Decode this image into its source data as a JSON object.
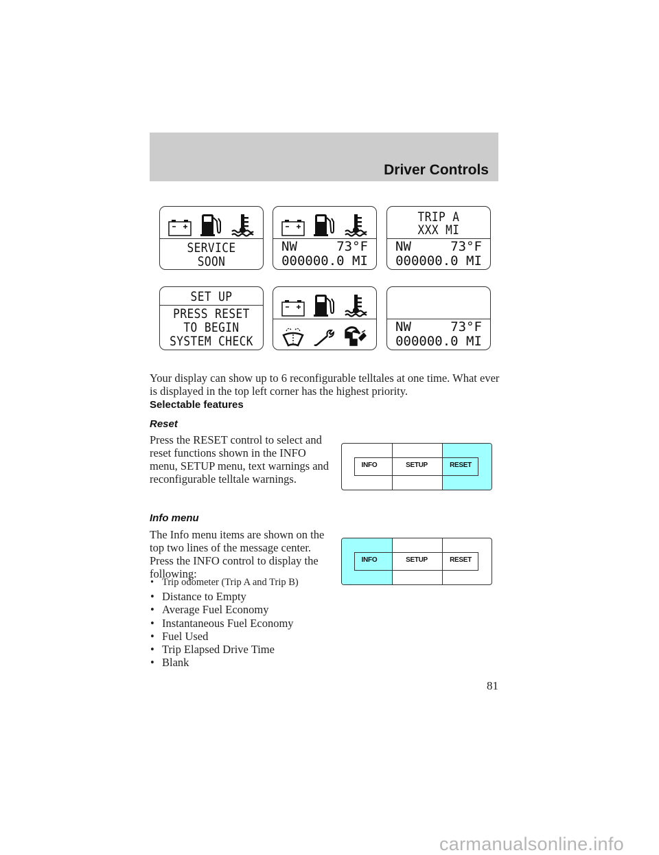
{
  "header": {
    "title": "Driver Controls"
  },
  "displays": [
    {
      "id": "service-soon",
      "top_icons": [
        "battery-icon",
        "fuel-pump-icon",
        "coolant-temperature-icon"
      ],
      "lines": [
        "SERVICE",
        "SOON"
      ]
    },
    {
      "id": "telltales-compass",
      "top_icons": [
        "battery-icon",
        "fuel-pump-icon",
        "coolant-temperature-icon"
      ],
      "compass": "NW",
      "temperature": "73°F",
      "odometer": "000000.0 MI"
    },
    {
      "id": "trip-a",
      "lines": [
        "TRIP A",
        "XXX MI"
      ],
      "compass": "NW",
      "temperature": "73°F",
      "odometer": "000000.0 MI"
    },
    {
      "id": "setup",
      "top_line": "SET UP",
      "lines": [
        "PRESS RESET",
        "TO BEGIN",
        "SYSTEM CHECK"
      ]
    },
    {
      "id": "six-telltales",
      "top_icons": [
        "battery-icon",
        "fuel-pump-icon",
        "coolant-temperature-icon"
      ],
      "bottom_icons": [
        "washer-fluid-icon",
        "wrench-icon",
        "door-ajar-icon"
      ]
    },
    {
      "id": "blank-top",
      "compass": "NW",
      "temperature": "73°F",
      "odometer": "000000.0 MI"
    }
  ],
  "intro_paragraph": "Your display can show up to 6 reconfigurable telltales at one time. What ever is displayed in the top left corner has the highest priority.",
  "section_heading": "Selectable features",
  "reset": {
    "heading": "Reset",
    "text": "Press the RESET control to select and reset functions shown in the INFO menu, SETUP menu, text warnings and reconfigurable telltale warnings.",
    "control": {
      "labels": [
        "INFO",
        "SETUP",
        "RESET"
      ],
      "active": "RESET",
      "highlight_color": "#a0ffff"
    }
  },
  "info_menu": {
    "heading": "Info menu",
    "text": "The Info menu items are shown on the top two lines of the message center. Press the INFO control to display the following:",
    "items": [
      "Trip odometer (Trip A and Trip B)",
      "Distance to Empty",
      "Average Fuel Economy",
      "Instantaneous Fuel Economy",
      "Fuel Used",
      "Trip Elapsed Drive Time",
      "Blank"
    ],
    "control": {
      "labels": [
        "INFO",
        "SETUP",
        "RESET"
      ],
      "active": "INFO",
      "highlight_color": "#a0ffff"
    }
  },
  "page_number": "81",
  "watermark": "carmanualsonline.info"
}
